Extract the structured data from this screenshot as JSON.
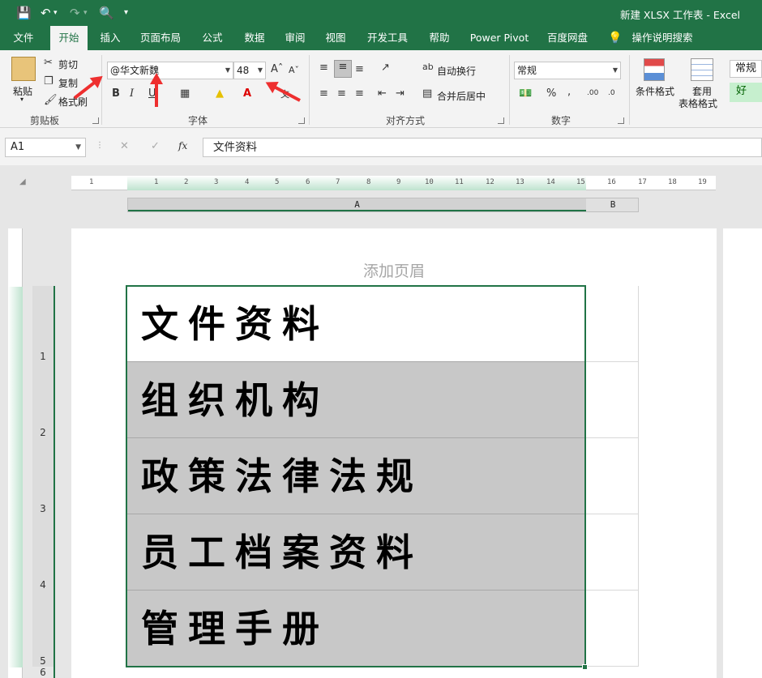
{
  "window": {
    "title": "新建 XLSX 工作表  -  Excel"
  },
  "quick_access": {
    "save_icon": "save-icon",
    "undo_icon": "undo-icon",
    "redo_icon": "redo-icon",
    "preview_icon": "print-preview-icon",
    "customize_icon": "customize-icon"
  },
  "tabs": [
    {
      "label": "文件"
    },
    {
      "label": "开始"
    },
    {
      "label": "插入"
    },
    {
      "label": "页面布局"
    },
    {
      "label": "公式"
    },
    {
      "label": "数据"
    },
    {
      "label": "审阅"
    },
    {
      "label": "视图"
    },
    {
      "label": "开发工具"
    },
    {
      "label": "帮助"
    },
    {
      "label": "Power Pivot"
    },
    {
      "label": "百度网盘"
    }
  ],
  "tell_me": {
    "label": "操作说明搜索",
    "icon": "lightbulb-icon"
  },
  "clipboard": {
    "paste": "粘贴",
    "cut": "剪切",
    "copy": "复制",
    "format_painter": "格式刷",
    "group": "剪贴板"
  },
  "font": {
    "name": "@华文新魏",
    "size": "48",
    "bold": "B",
    "italic": "I",
    "underline": "U",
    "group": "字体"
  },
  "alignment": {
    "wrap": "自动换行",
    "merge": "合并后居中",
    "group": "对齐方式"
  },
  "number": {
    "format": "常规",
    "percent": "%",
    "comma": ",",
    "group": "数字"
  },
  "styles": {
    "conditional": "条件格式",
    "table_format_1": "套用",
    "table_format_2": "表格格式",
    "normal_style": "常规",
    "good_style": "好"
  },
  "formula_bar": {
    "name_box": "A1",
    "fx": "fx",
    "content": "文件资料"
  },
  "sheet": {
    "header_placeholder": "添加页眉",
    "col_a": "A",
    "col_b": "B",
    "ruler_ticks": [
      "1",
      "1",
      "2",
      "3",
      "4",
      "5",
      "6",
      "7",
      "8",
      "9",
      "10",
      "11",
      "12",
      "13",
      "14",
      "15",
      "16",
      "17",
      "18",
      "19"
    ],
    "rows": [
      "1",
      "2",
      "3",
      "4",
      "5",
      "6"
    ],
    "cells": [
      "文件资料",
      "组织机构",
      "政策法律法规",
      "员工档案资料",
      "管理手册"
    ]
  },
  "colors": {
    "accent": "#217346",
    "highlight": "#c8c8c8",
    "arrow": "#ee2f2f"
  }
}
